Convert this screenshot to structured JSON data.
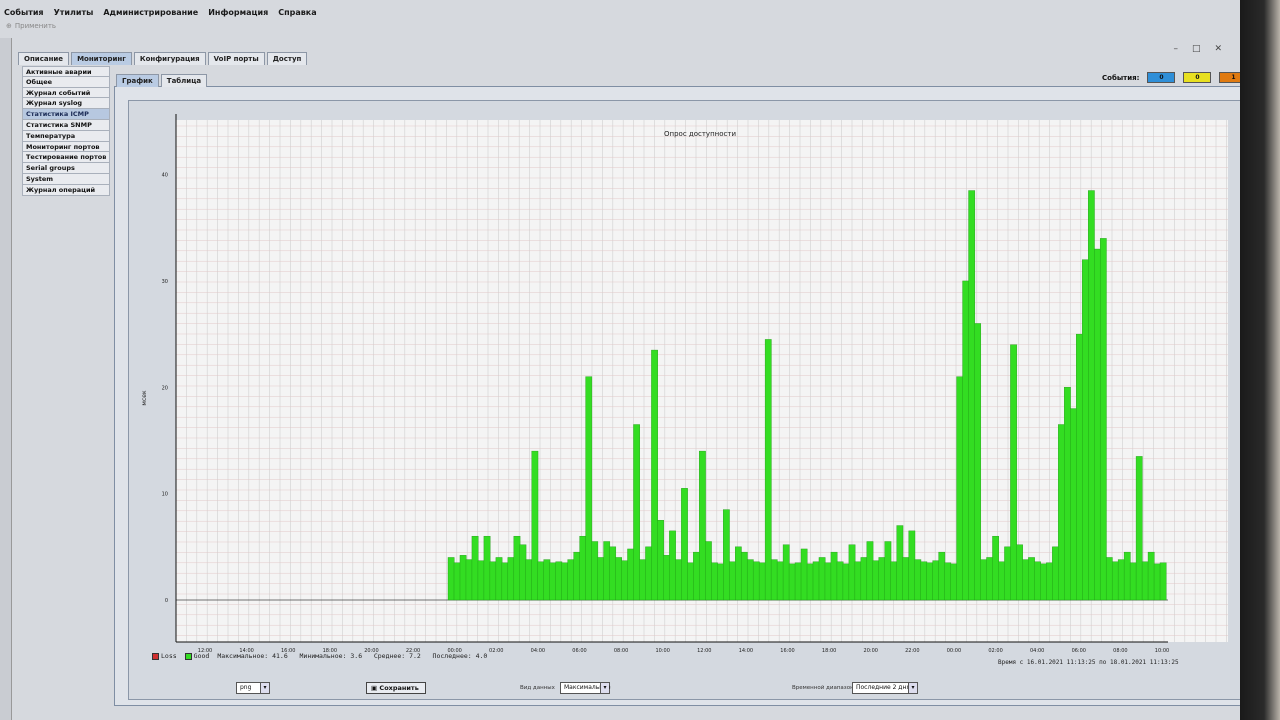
{
  "menu": [
    "События",
    "Утилиты",
    "Администрирование",
    "Информация",
    "Справка"
  ],
  "toolbar": {
    "apply_label": "Применить"
  },
  "main_tabs": [
    "Описание",
    "Мониторинг",
    "Конфигурация",
    "VoIP порты",
    "Доступ"
  ],
  "events": {
    "label": "События:",
    "counts": [
      "0",
      "0",
      "1",
      "0"
    ],
    "colors": [
      "#2f8fd8",
      "#e8e020",
      "#e07a10",
      "#d42020"
    ]
  },
  "sidebar": {
    "items": [
      "Активные аварии",
      "Общее",
      "Журнал событий",
      "Журнал syslog",
      "Статистика ICMP",
      "Статистика SNMP",
      "Температура",
      "Мониторинг портов",
      "Тестирование портов",
      "Serial groups",
      "System",
      "Журнал операций"
    ],
    "active_index": 4
  },
  "sub_tabs": [
    "График",
    "Таблица"
  ],
  "chart_data": {
    "type": "bar",
    "title": "Опрос доступности",
    "ylabel": "мсек",
    "ylim": [
      0,
      45
    ],
    "yticks": [
      0,
      10,
      20,
      30,
      40
    ],
    "xticks": [
      "12:00",
      "14:00",
      "16:00",
      "18:00",
      "20:00",
      "22:00",
      "00:00",
      "02:00",
      "04:00",
      "06:00",
      "08:00",
      "10:00",
      "12:00",
      "14:00",
      "16:00",
      "18:00",
      "20:00",
      "22:00",
      "00:00",
      "02:00",
      "04:00",
      "06:00",
      "08:00",
      "10:00"
    ],
    "series": [
      {
        "name": "Loss",
        "color": "#d03030",
        "values": []
      },
      {
        "name": "Good",
        "color": "#33dd22",
        "values": [
          4.0,
          3.5,
          4.2,
          3.8,
          6.0,
          3.7,
          6.0,
          3.6,
          4.0,
          3.5,
          4.0,
          6.0,
          5.2,
          3.8,
          14.0,
          3.6,
          3.8,
          3.5,
          3.6,
          3.5,
          3.8,
          4.5,
          6.0,
          21.0,
          5.5,
          4.0,
          5.5,
          5.0,
          4.0,
          3.7,
          4.8,
          16.5,
          3.8,
          5.0,
          23.5,
          7.5,
          4.2,
          6.5,
          3.8,
          10.5,
          3.5,
          4.5,
          14.0,
          5.5,
          3.5,
          3.4,
          8.5,
          3.6,
          5.0,
          4.5,
          3.8,
          3.6,
          3.5,
          24.5,
          3.8,
          3.6,
          5.2,
          3.4,
          3.5,
          4.8,
          3.4,
          3.6,
          4.0,
          3.5,
          4.5,
          3.6,
          3.4,
          5.2,
          3.6,
          4.0,
          5.5,
          3.7,
          4.0,
          5.5,
          3.6,
          7.0,
          4.0,
          6.5,
          3.8,
          3.6,
          3.5,
          3.7,
          4.5,
          3.5,
          3.4,
          21.0,
          30.0,
          38.5,
          26.0,
          3.8,
          4.0,
          6.0,
          3.6,
          5.0,
          24.0,
          5.2,
          3.8,
          4.0,
          3.6,
          3.4,
          3.5,
          5.0,
          16.5,
          20.0,
          18.0,
          25.0,
          32.0,
          38.5,
          33.0,
          34.0,
          4.0,
          3.6,
          3.8,
          4.5,
          3.5,
          13.5,
          3.6,
          4.5,
          3.4,
          3.5
        ]
      }
    ]
  },
  "legend": {
    "loss": "Loss",
    "good": "Good",
    "stats": "Максимальное: 41.6   Минимальное: 3.6   Среднее: 7.2   Последнее: 4.0"
  },
  "time_range_text": "Время с 16.01.2021 11:13:25 по 18.01.2021 11:13:25",
  "bottom": {
    "format_value": "png",
    "save_label": "Сохранить",
    "data_type_label": "Вид данных",
    "data_type_value": "Максимальное",
    "range_label": "Временной диапазон",
    "range_value": "Последние 2 дня"
  }
}
